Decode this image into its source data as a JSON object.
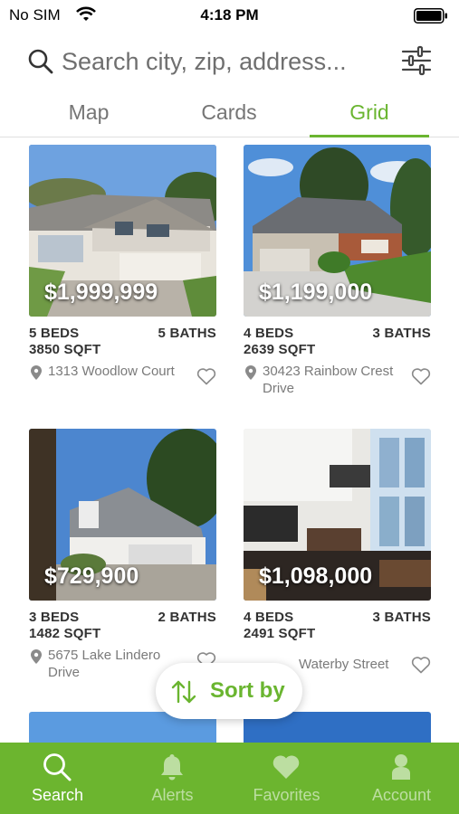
{
  "status_bar": {
    "carrier": "No SIM",
    "time": "4:18 PM"
  },
  "search": {
    "placeholder": "Search city, zip, address..."
  },
  "tabs": [
    {
      "label": "Map",
      "active": false
    },
    {
      "label": "Cards",
      "active": false
    },
    {
      "label": "Grid",
      "active": true
    }
  ],
  "listings": [
    {
      "price": "$1,999,999",
      "beds": "5 BEDS",
      "baths": "5 BATHS",
      "sqft": "3850 SQFT",
      "address": "1313 Woodlow Court"
    },
    {
      "price": "$1,199,000",
      "beds": "4 BEDS",
      "baths": "3 BATHS",
      "sqft": "2639 SQFT",
      "address": "30423 Rainbow Crest Drive"
    },
    {
      "price": "$729,900",
      "beds": "3 BEDS",
      "baths": "2 BATHS",
      "sqft": "1482 SQFT",
      "address": "5675 Lake Lindero Drive"
    },
    {
      "price": "$1,098,000",
      "beds": "4 BEDS",
      "baths": "3 BATHS",
      "sqft": "2491 SQFT",
      "address": "Waterby Street"
    }
  ],
  "sort": {
    "label": "Sort by"
  },
  "bottom_nav": [
    {
      "label": "Search",
      "icon": "search-icon",
      "active": true
    },
    {
      "label": "Alerts",
      "icon": "bell-icon",
      "active": false
    },
    {
      "label": "Favorites",
      "icon": "heart-icon",
      "active": false
    },
    {
      "label": "Account",
      "icon": "person-icon",
      "active": false
    }
  ],
  "colors": {
    "accent": "#6ab530",
    "nav_background": "#6cb52f"
  }
}
